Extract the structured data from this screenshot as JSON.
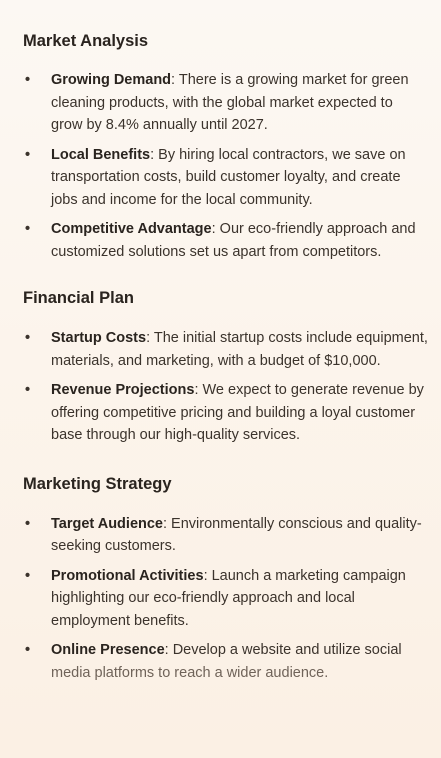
{
  "sections": [
    {
      "title": "Market Analysis",
      "items": [
        {
          "term": "Growing Demand",
          "text": ": There is a growing market for green cleaning products, with the global market expected to grow by 8.4% annually until 2027."
        },
        {
          "term": "Local Benefits",
          "text": ": By hiring local contractors, we save on transportation costs, build customer loyalty, and create jobs and income for the local community."
        },
        {
          "term": "Competitive Advantage",
          "text": ": Our eco-friendly approach and customized solutions set us apart from competitors."
        }
      ]
    },
    {
      "title": "Financial Plan",
      "items": [
        {
          "term": "Startup Costs",
          "text": ": The initial startup costs include equipment, materials, and marketing, with a budget of $10,000."
        },
        {
          "term": "Revenue Projections",
          "text": ": We expect to generate revenue by offering competitive pricing and building a loyal customer base through our high-quality services."
        }
      ]
    },
    {
      "title": "Marketing Strategy",
      "items": [
        {
          "term": "Target Audience",
          "text": ": Environmentally conscious and quality-seeking customers."
        },
        {
          "term": "Promotional Activities",
          "text": ": Launch a marketing campaign highlighting our eco-friendly approach and local employment benefits."
        },
        {
          "term": "Online Presence",
          "text": ": Develop a website and utilize social",
          "text_faded": " media platforms to reach a wider audience."
        }
      ]
    }
  ],
  "bullet_symbol": "•"
}
